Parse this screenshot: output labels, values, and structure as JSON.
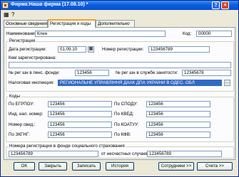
{
  "window": {
    "title": "Фирма:Наша фирма (17.08.10) *"
  },
  "tabs": [
    "Основные сведения",
    "Регистрация и коды",
    "Дополнительно"
  ],
  "top": {
    "name_label": "Наименование:",
    "name_value": "Клен",
    "code_label": "Код:",
    "code_value": "00000"
  },
  "registration": {
    "group_label": "Регистрация",
    "date_label": "Дата регистрации:",
    "date_value": "01.09.10",
    "number_label": "Номер регистрации:",
    "number_value": "123456789",
    "by_whom_label": "Кем зарегистрирована:",
    "by_whom_value": "",
    "pension_label": "№ рег шн в пенс. фонде:",
    "pension_value": "123456",
    "employment_label": "№ рег шн в службе занятости:",
    "employment_value": "12345678",
    "tax_label": "Налоговая инспекция:",
    "tax_value": "РЕГИОНАЛЬНЕ УПРАВЛІННЯ ДААК ДПА УКРАЇНИ В ОДЕС. ОБЛ"
  },
  "codes": {
    "group_label": "Коды",
    "edrpou_label": "По ЕГРПОУ:",
    "edrpou_value": "123456",
    "spodu_label": "По СПОДУ:",
    "spodu_value": "123456",
    "inn_label": "Инд. нал. номер:",
    "inn_value": "123456",
    "kved_label": "По КВЕД:",
    "kved_value": "123456",
    "cert_label": "Номер свид.:",
    "cert_value": "123456",
    "koatuu_label": "По КОАТУУ:",
    "koatuu_value": "123456",
    "zkgng_label": "По ЗКГНГ:",
    "zkgng_value": "123456",
    "kfv_label": "По КФВ:",
    "kfv_value": "123456"
  },
  "social": {
    "group_label": "Номера регистрации в фонде социального страхования",
    "value1": "123456789",
    "accidents_label": "от несчастных случаев:",
    "value2": "123456789"
  },
  "buttons": {
    "ok": "OK",
    "close": "Закрыть",
    "save": "Записать",
    "history": "История",
    "employees": "Сотрудники >>",
    "accounts": "Счета >>"
  }
}
